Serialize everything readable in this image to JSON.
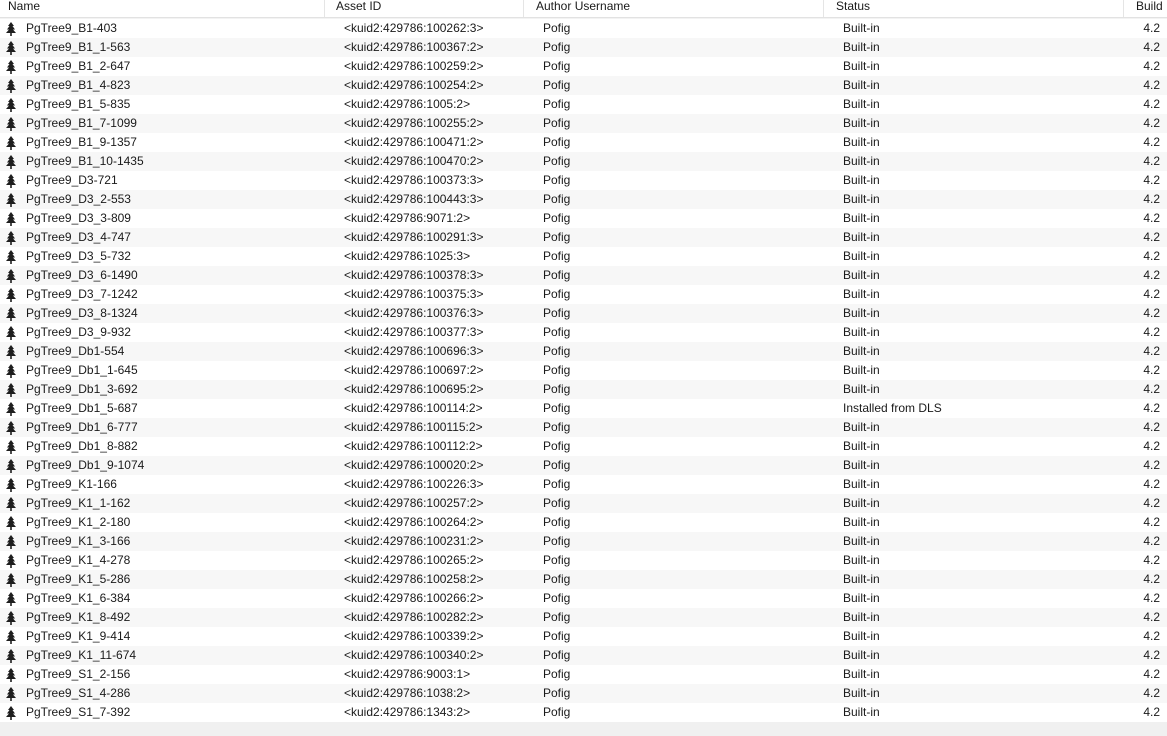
{
  "columns": {
    "name": "Name",
    "asset_id": "Asset ID",
    "author": "Author Username",
    "status": "Status",
    "build": "Build"
  },
  "row_icon": "tree-icon",
  "rows": [
    {
      "name": "PgTree9_B1-403",
      "asset_id": "<kuid2:429786:100262:3>",
      "author": "Pofig",
      "status": "Built-in",
      "build": "4.2"
    },
    {
      "name": "PgTree9_B1_1-563",
      "asset_id": "<kuid2:429786:100367:2>",
      "author": "Pofig",
      "status": "Built-in",
      "build": "4.2"
    },
    {
      "name": "PgTree9_B1_2-647",
      "asset_id": "<kuid2:429786:100259:2>",
      "author": "Pofig",
      "status": "Built-in",
      "build": "4.2"
    },
    {
      "name": "PgTree9_B1_4-823",
      "asset_id": "<kuid2:429786:100254:2>",
      "author": "Pofig",
      "status": "Built-in",
      "build": "4.2"
    },
    {
      "name": "PgTree9_B1_5-835",
      "asset_id": "<kuid2:429786:1005:2>",
      "author": "Pofig",
      "status": "Built-in",
      "build": "4.2"
    },
    {
      "name": "PgTree9_B1_7-1099",
      "asset_id": "<kuid2:429786:100255:2>",
      "author": "Pofig",
      "status": "Built-in",
      "build": "4.2"
    },
    {
      "name": "PgTree9_B1_9-1357",
      "asset_id": "<kuid2:429786:100471:2>",
      "author": "Pofig",
      "status": "Built-in",
      "build": "4.2"
    },
    {
      "name": "PgTree9_B1_10-1435",
      "asset_id": "<kuid2:429786:100470:2>",
      "author": "Pofig",
      "status": "Built-in",
      "build": "4.2"
    },
    {
      "name": "PgTree9_D3-721",
      "asset_id": "<kuid2:429786:100373:3>",
      "author": "Pofig",
      "status": "Built-in",
      "build": "4.2"
    },
    {
      "name": "PgTree9_D3_2-553",
      "asset_id": "<kuid2:429786:100443:3>",
      "author": "Pofig",
      "status": "Built-in",
      "build": "4.2"
    },
    {
      "name": "PgTree9_D3_3-809",
      "asset_id": "<kuid2:429786:9071:2>",
      "author": "Pofig",
      "status": "Built-in",
      "build": "4.2"
    },
    {
      "name": "PgTree9_D3_4-747",
      "asset_id": "<kuid2:429786:100291:3>",
      "author": "Pofig",
      "status": "Built-in",
      "build": "4.2"
    },
    {
      "name": "PgTree9_D3_5-732",
      "asset_id": "<kuid2:429786:1025:3>",
      "author": "Pofig",
      "status": "Built-in",
      "build": "4.2"
    },
    {
      "name": "PgTree9_D3_6-1490",
      "asset_id": "<kuid2:429786:100378:3>",
      "author": "Pofig",
      "status": "Built-in",
      "build": "4.2"
    },
    {
      "name": "PgTree9_D3_7-1242",
      "asset_id": "<kuid2:429786:100375:3>",
      "author": "Pofig",
      "status": "Built-in",
      "build": "4.2"
    },
    {
      "name": "PgTree9_D3_8-1324",
      "asset_id": "<kuid2:429786:100376:3>",
      "author": "Pofig",
      "status": "Built-in",
      "build": "4.2"
    },
    {
      "name": "PgTree9_D3_9-932",
      "asset_id": "<kuid2:429786:100377:3>",
      "author": "Pofig",
      "status": "Built-in",
      "build": "4.2"
    },
    {
      "name": "PgTree9_Db1-554",
      "asset_id": "<kuid2:429786:100696:3>",
      "author": "Pofig",
      "status": "Built-in",
      "build": "4.2"
    },
    {
      "name": "PgTree9_Db1_1-645",
      "asset_id": "<kuid2:429786:100697:2>",
      "author": "Pofig",
      "status": "Built-in",
      "build": "4.2"
    },
    {
      "name": "PgTree9_Db1_3-692",
      "asset_id": "<kuid2:429786:100695:2>",
      "author": "Pofig",
      "status": "Built-in",
      "build": "4.2"
    },
    {
      "name": "PgTree9_Db1_5-687",
      "asset_id": "<kuid2:429786:100114:2>",
      "author": "Pofig",
      "status": "Installed from DLS",
      "build": "4.2"
    },
    {
      "name": "PgTree9_Db1_6-777",
      "asset_id": "<kuid2:429786:100115:2>",
      "author": "Pofig",
      "status": "Built-in",
      "build": "4.2"
    },
    {
      "name": "PgTree9_Db1_8-882",
      "asset_id": "<kuid2:429786:100112:2>",
      "author": "Pofig",
      "status": "Built-in",
      "build": "4.2"
    },
    {
      "name": "PgTree9_Db1_9-1074",
      "asset_id": "<kuid2:429786:100020:2>",
      "author": "Pofig",
      "status": "Built-in",
      "build": "4.2"
    },
    {
      "name": "PgTree9_K1-166",
      "asset_id": "<kuid2:429786:100226:3>",
      "author": "Pofig",
      "status": "Built-in",
      "build": "4.2"
    },
    {
      "name": "PgTree9_K1_1-162",
      "asset_id": "<kuid2:429786:100257:2>",
      "author": "Pofig",
      "status": "Built-in",
      "build": "4.2"
    },
    {
      "name": "PgTree9_K1_2-180",
      "asset_id": "<kuid2:429786:100264:2>",
      "author": "Pofig",
      "status": "Built-in",
      "build": "4.2"
    },
    {
      "name": "PgTree9_K1_3-166",
      "asset_id": "<kuid2:429786:100231:2>",
      "author": "Pofig",
      "status": "Built-in",
      "build": "4.2"
    },
    {
      "name": "PgTree9_K1_4-278",
      "asset_id": "<kuid2:429786:100265:2>",
      "author": "Pofig",
      "status": "Built-in",
      "build": "4.2"
    },
    {
      "name": "PgTree9_K1_5-286",
      "asset_id": "<kuid2:429786:100258:2>",
      "author": "Pofig",
      "status": "Built-in",
      "build": "4.2"
    },
    {
      "name": "PgTree9_K1_6-384",
      "asset_id": "<kuid2:429786:100266:2>",
      "author": "Pofig",
      "status": "Built-in",
      "build": "4.2"
    },
    {
      "name": "PgTree9_K1_8-492",
      "asset_id": "<kuid2:429786:100282:2>",
      "author": "Pofig",
      "status": "Built-in",
      "build": "4.2"
    },
    {
      "name": "PgTree9_K1_9-414",
      "asset_id": "<kuid2:429786:100339:2>",
      "author": "Pofig",
      "status": "Built-in",
      "build": "4.2"
    },
    {
      "name": "PgTree9_K1_11-674",
      "asset_id": "<kuid2:429786:100340:2>",
      "author": "Pofig",
      "status": "Built-in",
      "build": "4.2"
    },
    {
      "name": "PgTree9_S1_2-156",
      "asset_id": "<kuid2:429786:9003:1>",
      "author": "Pofig",
      "status": "Built-in",
      "build": "4.2"
    },
    {
      "name": "PgTree9_S1_4-286",
      "asset_id": "<kuid2:429786:1038:2>",
      "author": "Pofig",
      "status": "Built-in",
      "build": "4.2"
    },
    {
      "name": "PgTree9_S1_7-392",
      "asset_id": "<kuid2:429786:1343:2>",
      "author": "Pofig",
      "status": "Built-in",
      "build": "4.2"
    }
  ]
}
